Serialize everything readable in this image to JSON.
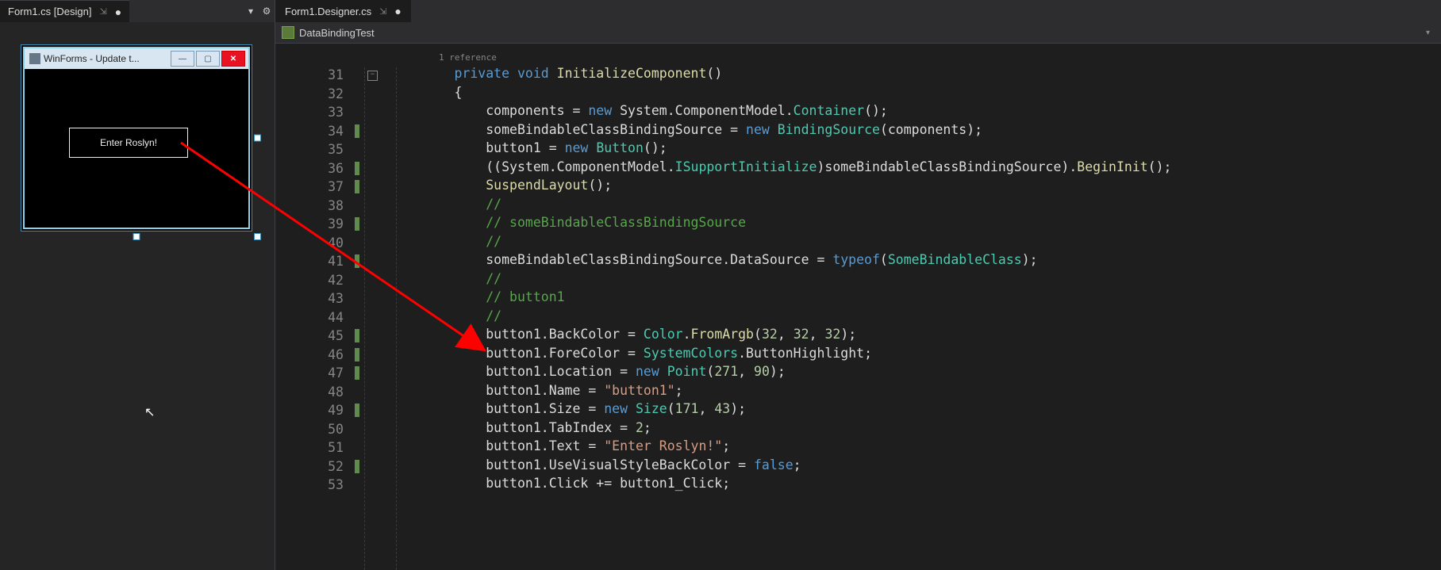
{
  "left": {
    "tab": {
      "label": "Form1.cs [Design]",
      "pinned_glyph": "⇲",
      "dirty_glyph": "●"
    },
    "tools": {
      "dropdown_glyph": "▾",
      "gear_glyph": "⚙"
    },
    "winform": {
      "title": "WinForms - Update t...",
      "button_text": "Enter Roslyn!",
      "min_glyph": "—",
      "max_glyph": "▢",
      "close_glyph": "✕"
    }
  },
  "right": {
    "tab": {
      "label": "Form1.Designer.cs",
      "pinned_glyph": "⇲",
      "dirty_glyph": "●"
    },
    "navbar": {
      "namespace": "DataBindingTest",
      "combo_glyph": "▾"
    },
    "codelens": "1 reference",
    "fold_glyph": "−",
    "lines": [
      {
        "n": 31,
        "m": false
      },
      {
        "n": 32,
        "m": false
      },
      {
        "n": 33,
        "m": false
      },
      {
        "n": 34,
        "m": true
      },
      {
        "n": 35,
        "m": false
      },
      {
        "n": 36,
        "m": true
      },
      {
        "n": 37,
        "m": true
      },
      {
        "n": 38,
        "m": false
      },
      {
        "n": 39,
        "m": true
      },
      {
        "n": 40,
        "m": false
      },
      {
        "n": 41,
        "m": true
      },
      {
        "n": 42,
        "m": false
      },
      {
        "n": 43,
        "m": false
      },
      {
        "n": 44,
        "m": false
      },
      {
        "n": 45,
        "m": true
      },
      {
        "n": 46,
        "m": true
      },
      {
        "n": 47,
        "m": true
      },
      {
        "n": 48,
        "m": false
      },
      {
        "n": 49,
        "m": true
      },
      {
        "n": 50,
        "m": false
      },
      {
        "n": 51,
        "m": false
      },
      {
        "n": 52,
        "m": true
      },
      {
        "n": 53,
        "m": false
      }
    ],
    "code": {
      "l31": {
        "indent": "        ",
        "tokens": [
          {
            "t": "private ",
            "c": "kw"
          },
          {
            "t": "void ",
            "c": "kw"
          },
          {
            "t": "InitializeComponent",
            "c": "mtd"
          },
          {
            "t": "()",
            "c": "pun"
          }
        ]
      },
      "l32": {
        "indent": "        ",
        "tokens": [
          {
            "t": "{",
            "c": "pun"
          }
        ]
      },
      "l33": {
        "indent": "            ",
        "tokens": [
          {
            "t": "components = ",
            "c": "id"
          },
          {
            "t": "new ",
            "c": "kw"
          },
          {
            "t": "System.ComponentModel.",
            "c": "id"
          },
          {
            "t": "Container",
            "c": "typ"
          },
          {
            "t": "();",
            "c": "pun"
          }
        ]
      },
      "l34": {
        "indent": "            ",
        "tokens": [
          {
            "t": "someBindableClassBindingSource = ",
            "c": "id"
          },
          {
            "t": "new ",
            "c": "kw"
          },
          {
            "t": "BindingSource",
            "c": "typ"
          },
          {
            "t": "(components);",
            "c": "pun"
          }
        ]
      },
      "l35": {
        "indent": "            ",
        "tokens": [
          {
            "t": "button1 = ",
            "c": "id"
          },
          {
            "t": "new ",
            "c": "kw"
          },
          {
            "t": "Button",
            "c": "typ"
          },
          {
            "t": "();",
            "c": "pun"
          }
        ]
      },
      "l36": {
        "indent": "            ",
        "tokens": [
          {
            "t": "((System.ComponentModel.",
            "c": "pun"
          },
          {
            "t": "ISupportInitialize",
            "c": "typ"
          },
          {
            "t": ")someBindableClassBindingSource).",
            "c": "pun"
          },
          {
            "t": "BeginInit",
            "c": "mtd"
          },
          {
            "t": "();",
            "c": "pun"
          }
        ]
      },
      "l37": {
        "indent": "            ",
        "tokens": [
          {
            "t": "SuspendLayout",
            "c": "mtd"
          },
          {
            "t": "();",
            "c": "pun"
          }
        ]
      },
      "l38": {
        "indent": "            ",
        "tokens": [
          {
            "t": "// ",
            "c": "cmt"
          }
        ]
      },
      "l39": {
        "indent": "            ",
        "tokens": [
          {
            "t": "// someBindableClassBindingSource",
            "c": "cmt"
          }
        ]
      },
      "l40": {
        "indent": "            ",
        "tokens": [
          {
            "t": "// ",
            "c": "cmt"
          }
        ]
      },
      "l41": {
        "indent": "            ",
        "tokens": [
          {
            "t": "someBindableClassBindingSource.DataSource = ",
            "c": "id"
          },
          {
            "t": "typeof",
            "c": "kw"
          },
          {
            "t": "(",
            "c": "pun"
          },
          {
            "t": "SomeBindableClass",
            "c": "typ"
          },
          {
            "t": ");",
            "c": "pun"
          }
        ]
      },
      "l42": {
        "indent": "            ",
        "tokens": [
          {
            "t": "// ",
            "c": "cmt"
          }
        ]
      },
      "l43": {
        "indent": "            ",
        "tokens": [
          {
            "t": "// button1",
            "c": "cmt"
          }
        ]
      },
      "l44": {
        "indent": "            ",
        "tokens": [
          {
            "t": "// ",
            "c": "cmt"
          }
        ]
      },
      "l45": {
        "indent": "            ",
        "tokens": [
          {
            "t": "button1.BackColor = ",
            "c": "id"
          },
          {
            "t": "Color",
            "c": "typ"
          },
          {
            "t": ".",
            "c": "pun"
          },
          {
            "t": "FromArgb",
            "c": "mtd"
          },
          {
            "t": "(",
            "c": "pun"
          },
          {
            "t": "32",
            "c": "num"
          },
          {
            "t": ", ",
            "c": "pun"
          },
          {
            "t": "32",
            "c": "num"
          },
          {
            "t": ", ",
            "c": "pun"
          },
          {
            "t": "32",
            "c": "num"
          },
          {
            "t": ");",
            "c": "pun"
          }
        ]
      },
      "l46": {
        "indent": "            ",
        "tokens": [
          {
            "t": "button1.ForeColor = ",
            "c": "id"
          },
          {
            "t": "SystemColors",
            "c": "typ"
          },
          {
            "t": ".ButtonHighlight;",
            "c": "pun"
          }
        ]
      },
      "l47": {
        "indent": "            ",
        "tokens": [
          {
            "t": "button1.Location = ",
            "c": "id"
          },
          {
            "t": "new ",
            "c": "kw"
          },
          {
            "t": "Point",
            "c": "typ"
          },
          {
            "t": "(",
            "c": "pun"
          },
          {
            "t": "271",
            "c": "num"
          },
          {
            "t": ", ",
            "c": "pun"
          },
          {
            "t": "90",
            "c": "num"
          },
          {
            "t": ");",
            "c": "pun"
          }
        ]
      },
      "l48": {
        "indent": "            ",
        "tokens": [
          {
            "t": "button1.Name = ",
            "c": "id"
          },
          {
            "t": "\"button1\"",
            "c": "str"
          },
          {
            "t": ";",
            "c": "pun"
          }
        ]
      },
      "l49": {
        "indent": "            ",
        "tokens": [
          {
            "t": "button1.Size = ",
            "c": "id"
          },
          {
            "t": "new ",
            "c": "kw"
          },
          {
            "t": "Size",
            "c": "typ"
          },
          {
            "t": "(",
            "c": "pun"
          },
          {
            "t": "171",
            "c": "num"
          },
          {
            "t": ", ",
            "c": "pun"
          },
          {
            "t": "43",
            "c": "num"
          },
          {
            "t": ");",
            "c": "pun"
          }
        ]
      },
      "l50": {
        "indent": "            ",
        "tokens": [
          {
            "t": "button1.TabIndex = ",
            "c": "id"
          },
          {
            "t": "2",
            "c": "num"
          },
          {
            "t": ";",
            "c": "pun"
          }
        ]
      },
      "l51": {
        "indent": "            ",
        "tokens": [
          {
            "t": "button1.Text = ",
            "c": "id"
          },
          {
            "t": "\"Enter Roslyn!\"",
            "c": "str"
          },
          {
            "t": ";",
            "c": "pun"
          }
        ]
      },
      "l52": {
        "indent": "            ",
        "tokens": [
          {
            "t": "button1.UseVisualStyleBackColor = ",
            "c": "id"
          },
          {
            "t": "false",
            "c": "kw"
          },
          {
            "t": ";",
            "c": "pun"
          }
        ]
      },
      "l53": {
        "indent": "            ",
        "tokens": [
          {
            "t": "button1.Click += button1_Click;",
            "c": "id"
          }
        ]
      }
    }
  }
}
